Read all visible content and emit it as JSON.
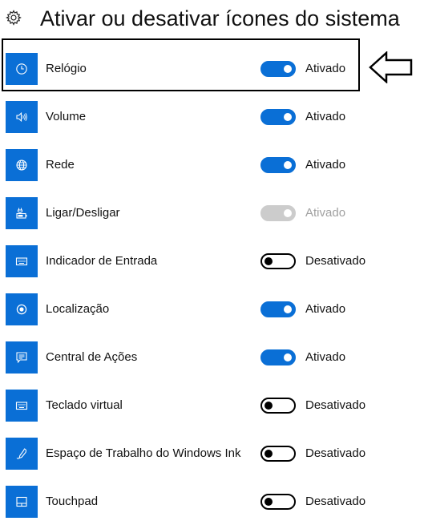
{
  "page": {
    "title": "Ativar ou desativar ícones do sistema",
    "header_icon": "gear-icon"
  },
  "colors": {
    "accent": "#0a6fd6",
    "disabled_toggle": "#cccccc",
    "disabled_text": "#a0a0a0"
  },
  "items": [
    {
      "label": "Relógio",
      "icon": "clock-icon",
      "state": "Ativado",
      "on": true,
      "enabled": true,
      "highlighted": true
    },
    {
      "label": "Volume",
      "icon": "speaker-icon",
      "state": "Ativado",
      "on": true,
      "enabled": true
    },
    {
      "label": "Rede",
      "icon": "globe-icon",
      "state": "Ativado",
      "on": true,
      "enabled": true
    },
    {
      "label": "Ligar/Desligar",
      "icon": "battery-plug-icon",
      "state": "Ativado",
      "on": true,
      "enabled": false
    },
    {
      "label": "Indicador de Entrada",
      "icon": "keyboard-icon",
      "state": "Desativado",
      "on": false,
      "enabled": true
    },
    {
      "label": "Localização",
      "icon": "location-icon",
      "state": "Ativado",
      "on": true,
      "enabled": true
    },
    {
      "label": "Central de Ações",
      "icon": "action-center-icon",
      "state": "Ativado",
      "on": true,
      "enabled": true
    },
    {
      "label": "Teclado virtual",
      "icon": "keyboard-icon",
      "state": "Desativado",
      "on": false,
      "enabled": true
    },
    {
      "label": "Espaço de Trabalho do Windows Ink",
      "icon": "pen-icon",
      "state": "Desativado",
      "on": false,
      "enabled": true
    },
    {
      "label": "Touchpad",
      "icon": "touchpad-icon",
      "state": "Desativado",
      "on": false,
      "enabled": true
    }
  ],
  "annotation": {
    "arrow_icon": "left-arrow-icon"
  }
}
